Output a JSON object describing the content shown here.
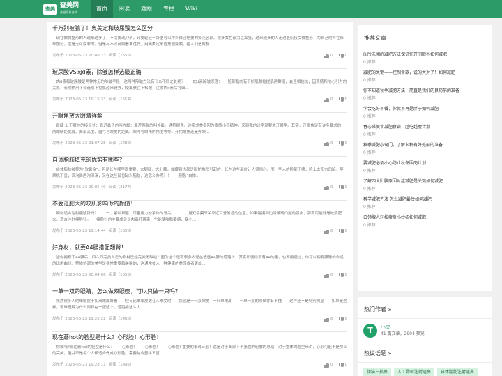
{
  "brand": {
    "logo_box": "查美",
    "name": "查美网",
    "tagline": "查经资料查询"
  },
  "nav": [
    "首页",
    "阅读",
    "题跟",
    "专栏",
    "Wiki"
  ],
  "articles": [
    {
      "title": "千万别被骗了！奥美定和玻尿酸怎么区分",
      "summary": "现在做微整形的人越来越多了，不需要动刀子，只要轻轻一针便可以得到自己想要的如花容颜。很多女性都为之痴狂，越来越多的人走进医院接受微整形，为自己的外在形象加分。这是无可厚非的，但是有不法商贩看准这块，用奥美定来冒充玻尿酸，给人们造成极...",
      "date": "发布于 2023-05-23 20:40:23",
      "views": "阅读（1555）",
      "likes": "0",
      "dislikes": "0"
    },
    {
      "title": "玻尿酸VS肉d素，除皱怎样选最正确",
      "summary": "肉d素和玻尿酸是两种常见的除皱手段，这两种除皱方法有什么不同之处呢？　　肉d素除皱原理：　　脸部肌肉有下抗肌和拉提肌两群组，会互相拮抗，因表情和地心引力的关系，长期作用下会造成下拉肌越来越强，使皮肤往下松弛，注射肉d素后可毁...",
      "date": "发布于 2023-05-23 19:15:33",
      "views": "阅读（1514）",
      "likes": "0",
      "dislikes": "0"
    },
    {
      "title": "开眼角放大眼睛详解",
      "summary": "目睫 上下眼睑的接合处；靠近鼻子的叫内眦；靠近两鬓的叫外眦。通称眼角。许多求美者因为眼睛小不精神，来到我的诊室就要求开眼角。其实，开眼角是有许多要求的，两眼睛距宽度、鼻梁高度、眉弓与眼皮的距离、眼沟与眼角的角度等等。开内眼角还是外眼...",
      "date": "发布于 2023-05-23 21:07:28",
      "views": "阅读（1489）",
      "likes": "0",
      "dislikes": "0"
    },
    {
      "title": "自体脂肪填充的优势有哪些？",
      "summary": "自体脂肪被称为\"软黄金\"，但是长在哪里很重要，大腿腿，大肚腩，蝴蝶臂也都是脂肪堆积引起的，长在这些部位让人很闹心。而一些人的脸部干瘪，脸上太阳穴凹陷，苹果机下垂，泪沟鼻唇沟深深，又在这些部位缺少脂肪，这怎么办呢？！　　别急\"自体...",
      "date": "发布于 2023-05-23 20:05:40",
      "views": "阅读（2174）",
      "likes": "0",
      "dislikes": "0"
    },
    {
      "title": "不要让肥大的咬肌影响你的颜值！",
      "summary": "咧你适合注射瘦脸针吗？　　一、紧咬双唇，尽量用力咬紧你的牙关。　　二、用双手摸牙关靠近耳垂附近的位置，如果能摸到边沿硬硬凸起的肌肉，那有可能就是咬肌肥大，适合注射瘦脸针。　　瘦脸针的主要成分是肉毒杆菌素，它能使咬肌萎缩，变小...",
      "date": "发布于 2023-05-23 19:14:44",
      "views": "阅读（1608）",
      "likes": "0",
      "dislikes": "0"
    },
    {
      "title": "好身材，就要A4腰搭配翘臀！",
      "summary": "当你拥有了A4腰后，四六四完美自己的身材已经完美无缺啦？因为这个还有很多人还在追逐A4腰的道路上，其实即便你没有A4的腰，也不用埋过，你可以拥有腰臀的合适的比例曲线，整体协调的美学是非常重要和关键的，这通常被人一种健康的美感或者更加...",
      "date": "发布于 2023-05-23 20:04:06",
      "views": "阅读（1555）",
      "likes": "0",
      "dislikes": "0"
    },
    {
      "title": "一单一双的眼睛，怎么做双眼皮，可以只做一只吗？",
      "summary": "虽然很多人的单眼皮不如双眼皮好看　　但有比单眼皮更让人难受的　　那就是一只双眼皮+一只单眼皮　　一单一双的烦恼你有不懂　　这样还不是特别明显　　如果是这样，很难理解为什么同样在一张脸上，差距会这么大...",
      "date": "发布于 2023-05-23 19:25:22",
      "views": "阅读（1460）",
      "likes": "0",
      "dislikes": "0"
    },
    {
      "title": "现在蘑hot的脸型是什么？心形脸！心形脸！",
      "summary": "你或吗?现在蘑hot的脸型是什么？　　心形脸！　　心形脸！　　心形脸! 重要的事说三遍！这是对于面部下半张脸的轮廓的总结：对于整体的脸型来讲，心形可能不是那么的完美，但并不是每个人都适合做成心形脸，需要结合整体五官...",
      "date": "发布于 2023-05-23 19:28:11",
      "views": "阅读（1492）",
      "likes": "0",
      "dislikes": "0"
    }
  ],
  "recommend": {
    "title": "推荐文章",
    "items": [
      {
        "title": "闺所未闻的减肥方法保证你开间眼界如何减肥",
        "count": "0 推荐"
      },
      {
        "title": "减肥的关键——控制食欲，说的大对了！如何减肥",
        "count": "0 推荐"
      },
      {
        "title": "你不知道秋季减肥方法，简直是我们的良药前的准备",
        "count": "0 推荐"
      },
      {
        "title": "学会吃好早餐，你就不再是胖子如何减肥",
        "count": "0 推荐"
      },
      {
        "title": "春心采美食减肥食谱，越吃越瘦计划",
        "count": "0 推荐"
      },
      {
        "title": "秋季减肥小窍门，了解玄机有好处前的准备",
        "count": "0 推荐"
      },
      {
        "title": "要减肥必须小心防止秋冬围肉计划",
        "count": "0 推荐"
      },
      {
        "title": "了解四大肚腩原因对症减肥是关键如何减肥",
        "count": "0 推荐"
      },
      {
        "title": "科学减肥方法 怎么减肥最快如何减肥",
        "count": "0 推荐"
      },
      {
        "title": "白领腺人轻松瘦身小妙招如何减肥",
        "count": "0 推荐"
      }
    ]
  },
  "authors": {
    "title": "热门作者 »",
    "name": "小文",
    "stats": "41 篇文章，2904 预览",
    "avatar_letter": "T"
  },
  "topics": {
    "title": "热议话题 »",
    "tags": [
      "伊猫三指鼻",
      "人工骨框注射隆鼻",
      "自体脂肪注射隆鼻"
    ]
  },
  "colors": {
    "brand": "#2c9b68",
    "tag_bg": "#d6f2e1"
  }
}
